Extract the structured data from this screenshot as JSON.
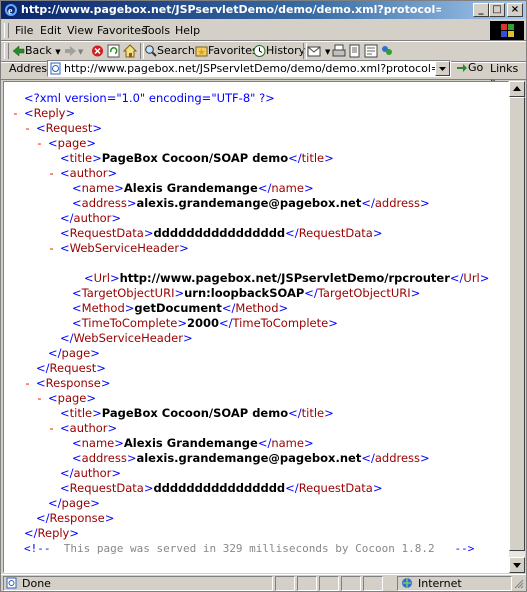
{
  "window": {
    "title": "http://www.pagebox.net/JSPservletDemo/demo/demo.xml?protocol=SOAP&query=dddddd..."
  },
  "menu": [
    "File",
    "Edit",
    "View",
    "Favorites",
    "Tools",
    "Help"
  ],
  "toolbar": {
    "back": "Back",
    "search": "Search",
    "favorites": "Favorites",
    "history": "History"
  },
  "address": {
    "label": "Address",
    "value": "http://www.pagebox.net/JSPservletDemo/demo/demo.xml?protocol=SOAP&query=dddd",
    "go": "Go",
    "links": "Links"
  },
  "xml": {
    "declaration": "<?xml version=\"1.0\" encoding=\"UTF-8\" ?>",
    "reply": "Reply",
    "request": "Request",
    "response": "Response",
    "page": "page",
    "title_tag": "title",
    "title_text": "PageBox Cocoon/SOAP demo",
    "author": "author",
    "name_tag": "name",
    "name_text": "Alexis Grandemange",
    "address_tag": "address",
    "address_text": "alexis.grandemange@pagebox.net",
    "requestdata_tag": "RequestData",
    "requestdata_text1": "dddddddddddddddd",
    "requestdata_text2": "dddddddddddddddd",
    "wsheader": "WebServiceHeader",
    "url_tag": "Url",
    "url_text": "http://www.pagebox.net/JSPservletDemo/rpcrouter",
    "target_tag": "TargetObjectURI",
    "target_text": "urn:loopbackSOAP",
    "method_tag": "Method",
    "method_text": "getDocument",
    "ttc_tag": "TimeToComplete",
    "ttc_text": "2000",
    "comment_open": "<!--",
    "comment_text": "This page was served in 329 milliseconds by Cocoon 1.8.2",
    "comment_close": "-->"
  },
  "status": {
    "left": "Done",
    "zone": "Internet"
  }
}
